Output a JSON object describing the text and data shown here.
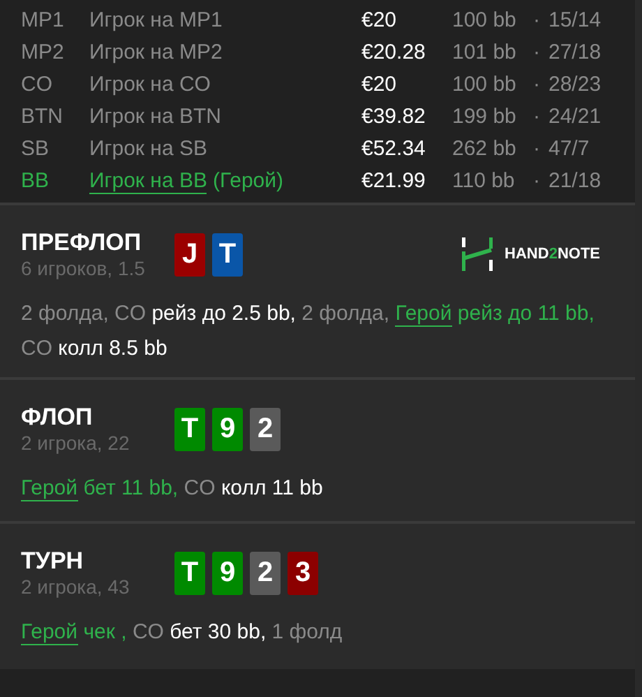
{
  "players": [
    {
      "position": "MP1",
      "name": "Игрок на MP1",
      "hero": false,
      "stack": "€20",
      "bb": "100 bb",
      "sep": "·",
      "stats": "15/14"
    },
    {
      "position": "MP2",
      "name": "Игрок на MP2",
      "hero": false,
      "stack": "€20.28",
      "bb": "101 bb",
      "sep": "·",
      "stats": "27/18"
    },
    {
      "position": "CO",
      "name": "Игрок на CO",
      "hero": false,
      "stack": "€20",
      "bb": "100 bb",
      "sep": "·",
      "stats": "28/23"
    },
    {
      "position": "BTN",
      "name": "Игрок на BTN",
      "hero": false,
      "stack": "€39.82",
      "bb": "199 bb",
      "sep": "·",
      "stats": "24/21"
    },
    {
      "position": "SB",
      "name": "Игрок на SB",
      "hero": false,
      "stack": "€52.34",
      "bb": "262 bb",
      "sep": "·",
      "stats": "47/7"
    },
    {
      "position": "BB",
      "name": "Игрок на BB",
      "hero": true,
      "hero_tag": "(Герой)",
      "stack": "€21.99",
      "bb": "110 bb",
      "sep": "·",
      "stats": "21/18"
    }
  ],
  "logo": {
    "before": "HAND",
    "accent": "2",
    "after": "NOTE"
  },
  "streets": [
    {
      "title": "ПРЕФЛОП",
      "subtitle": "6 игроков, 1.5",
      "logo": true,
      "cards": [
        {
          "rank": "J",
          "color": "#9b0000"
        },
        {
          "rank": "T",
          "color": "#0a56a8"
        }
      ],
      "actions": [
        {
          "kind": "muted",
          "text": "2 фолда, CO"
        },
        {
          "kind": "action",
          "text": "рейз до 2.5 bb,"
        },
        {
          "kind": "muted",
          "text": "2 фолда,"
        },
        {
          "kind": "hero",
          "text": "Герой"
        },
        {
          "kind": "hero-action",
          "text": "рейз до 11 bb,"
        },
        {
          "kind": "muted",
          "text": "CO"
        },
        {
          "kind": "action",
          "text": "колл 8.5 bb"
        }
      ]
    },
    {
      "title": "ФЛОП",
      "subtitle": "2 игрока, 22",
      "logo": false,
      "cards": [
        {
          "rank": "T",
          "color": "#008a00"
        },
        {
          "rank": "9",
          "color": "#008a00"
        },
        {
          "rank": "2",
          "color": "#5a5a5a"
        }
      ],
      "actions": [
        {
          "kind": "hero",
          "text": "Герой"
        },
        {
          "kind": "hero-action",
          "text": "бет 11 bb,"
        },
        {
          "kind": "muted",
          "text": "CO"
        },
        {
          "kind": "action",
          "text": "колл 11 bb"
        }
      ]
    },
    {
      "title": "ТУРН",
      "subtitle": "2 игрока, 43",
      "logo": false,
      "cards": [
        {
          "rank": "T",
          "color": "#008a00"
        },
        {
          "rank": "9",
          "color": "#008a00"
        },
        {
          "rank": "2",
          "color": "#5a5a5a"
        },
        {
          "rank": "3",
          "color": "#8c0000"
        }
      ],
      "actions": [
        {
          "kind": "hero",
          "text": "Герой"
        },
        {
          "kind": "hero-action",
          "text": "чек ,"
        },
        {
          "kind": "muted",
          "text": "CO"
        },
        {
          "kind": "action",
          "text": "бет 30 bb,"
        },
        {
          "kind": "muted",
          "text": "1 фолд"
        }
      ]
    }
  ]
}
